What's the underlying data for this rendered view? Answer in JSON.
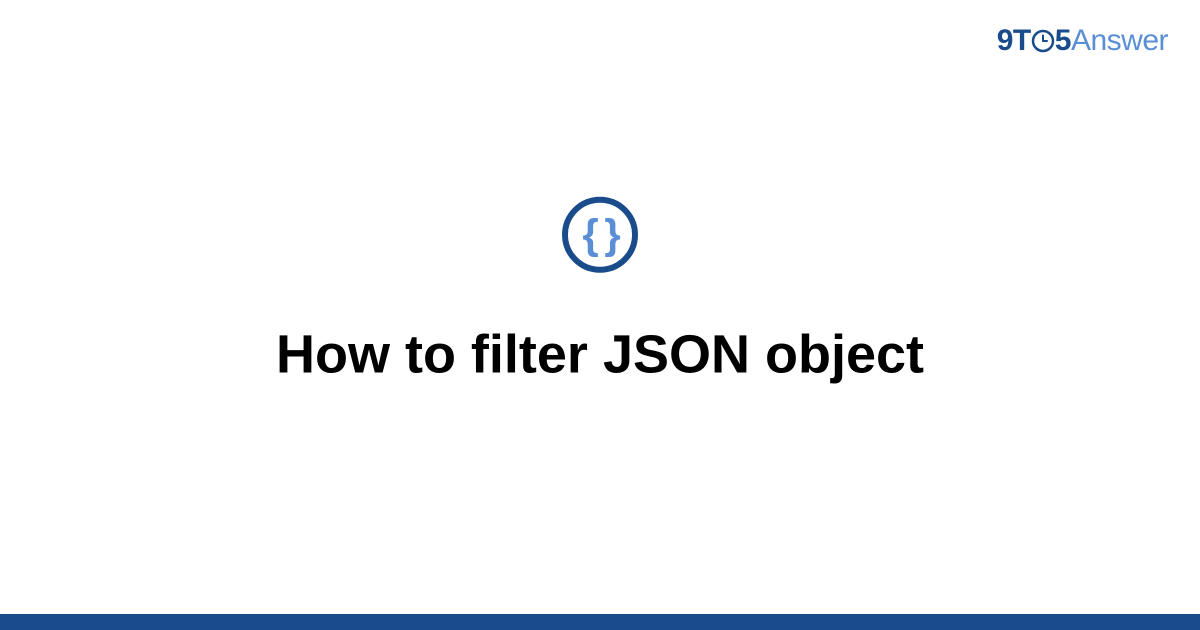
{
  "brand": {
    "part1": "9T",
    "part2": "5",
    "part3": "Answer"
  },
  "icon": {
    "glyph": "{ }"
  },
  "main": {
    "title": "How to filter JSON object"
  },
  "colors": {
    "brand_dark": "#1a4c8b",
    "brand_light": "#5a8fd6"
  }
}
